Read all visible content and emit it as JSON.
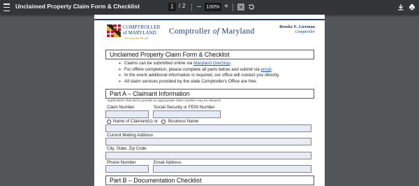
{
  "toolbar": {
    "menu_icon": "hamburger-menu-icon",
    "title": "Unclaimed Property Claim Form & Checklist",
    "current_page": "1",
    "page_separator": "/",
    "total_pages": "2",
    "zoom_out": "–",
    "zoom_level": "100%",
    "zoom_in": "+",
    "fit_icon": "fit-page-icon",
    "rotate_icon": "rotate-icon",
    "download_icon": "download-icon",
    "print_icon": "print-icon"
  },
  "letterhead": {
    "logo_line1": "COMPTROLLER",
    "logo_line2": "of MARYLAND",
    "logo_tagline": "Serving the People",
    "title_main": "Comptroller ",
    "title_of": "of",
    "title_state": " Maryland",
    "official_name": "Brooke E. Lierman",
    "official_role": "Comptroller"
  },
  "form": {
    "heading": "Unclaimed Property Claim Form & Checklist",
    "bullets": {
      "b1_pre": "Claims can be submitted online via ",
      "b1_link": "Maryland OneStop",
      "b1_post": ".",
      "b2_pre": "For offline completion, please complete all parts below and submit via ",
      "b2_link": "email",
      "b2_post": ".",
      "b3": "In the event additional information is required, our office will contact you directly.",
      "b4": "All claim services provided by the state Comptroller's Office are free."
    },
    "part_a": {
      "title": "Part A – Claimant Information",
      "note": "Applications that fail to provide an appropriate claim number may be delayed.",
      "claim_number": "Claim Number",
      "ssn_fein": "Social Security or FEIN Number",
      "name_of_claimant": "Name of Claimant(s) or",
      "business_name": "Business Name",
      "mailing_address": "Current Mailing Address",
      "city_state_zip": "City, State, Zip Code",
      "phone": "Phone Number",
      "email": "Email Address"
    },
    "part_b": {
      "title": "Part B – Documentation Checklist"
    }
  },
  "colors": {
    "toolbar_bg": "#323639",
    "viewer_bg": "#525659",
    "brand_blue": "#1f3a7a",
    "field_fill": "#e6ebf4",
    "link": "#1155cc"
  }
}
